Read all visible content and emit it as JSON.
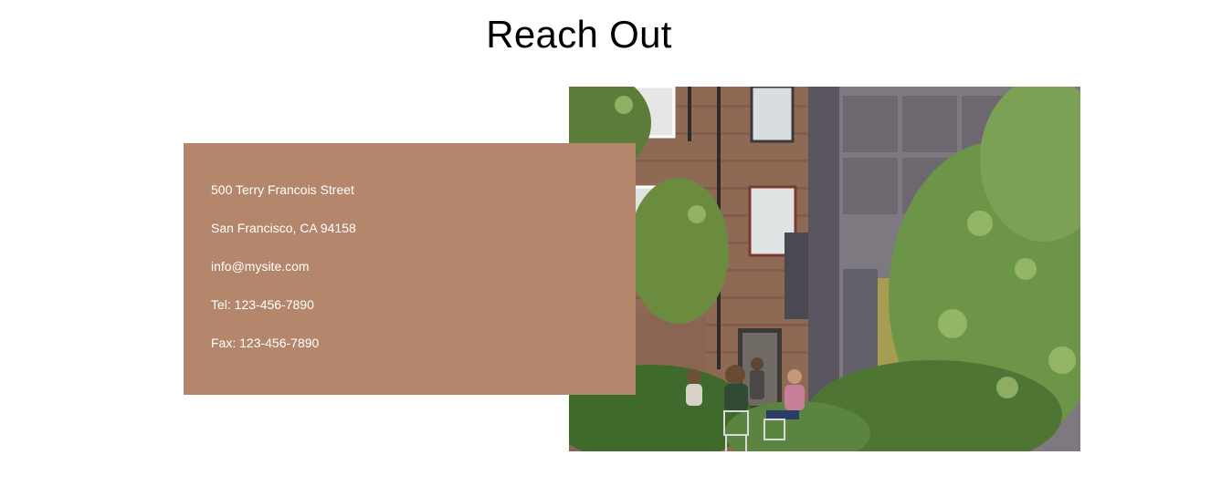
{
  "heading": "Reach Out",
  "contact": {
    "address_line1": "500 Terry Francois Street",
    "address_line2": "San Francisco, CA 94158",
    "email": "info@mysite.com",
    "phone": "Tel: 123-456-7890",
    "fax": "Fax: 123-456-7890"
  },
  "colors": {
    "card_background": "#b4866b",
    "card_text": "#ffffff",
    "heading_text": "#000000"
  }
}
